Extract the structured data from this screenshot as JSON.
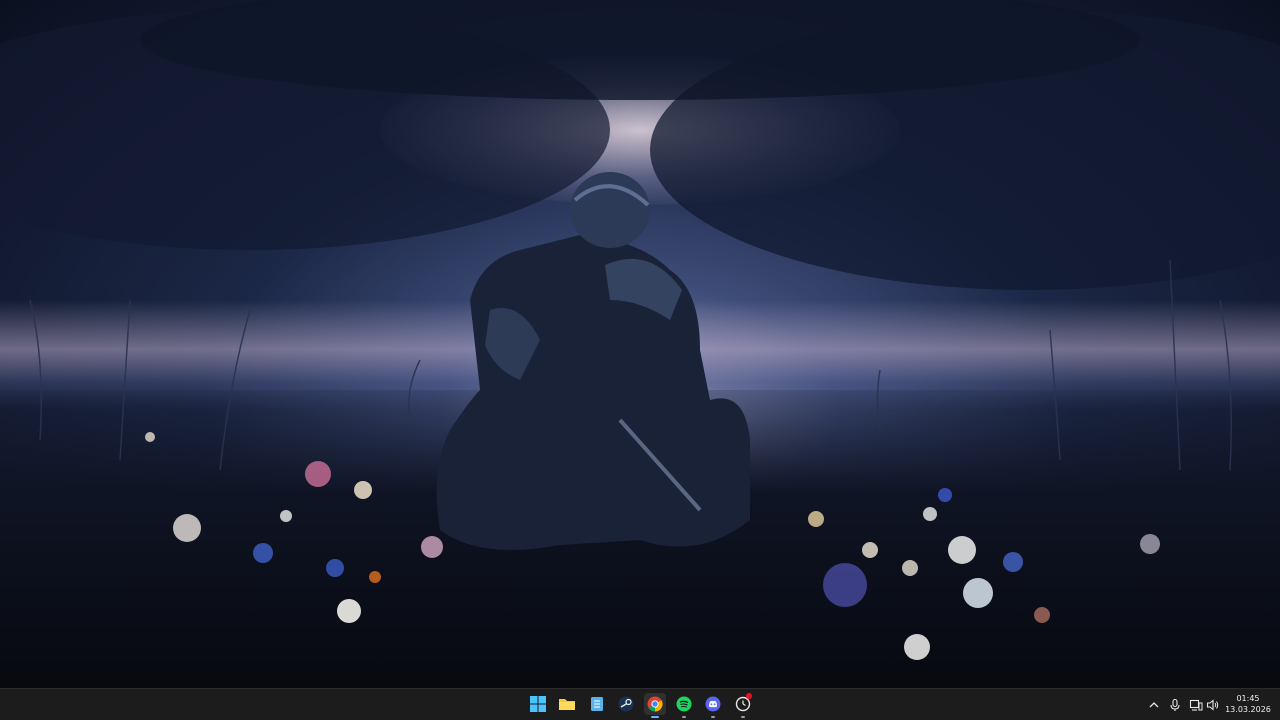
{
  "desktop": {
    "wallpaper": "knight-in-meadow-wallpaper"
  },
  "taskbar": {
    "apps": [
      {
        "name": "start-button",
        "icon": "windows-logo-icon",
        "running": false
      },
      {
        "name": "file-explorer",
        "icon": "folder-icon",
        "running": false
      },
      {
        "name": "notepad",
        "icon": "notepad-icon",
        "running": false
      },
      {
        "name": "steam",
        "icon": "steam-icon",
        "running": false
      },
      {
        "name": "chrome",
        "icon": "chrome-icon",
        "running": true,
        "active": true
      },
      {
        "name": "spotify",
        "icon": "spotify-icon",
        "running": true
      },
      {
        "name": "discord",
        "icon": "discord-icon",
        "running": true
      },
      {
        "name": "app-with-notification",
        "icon": "clock-app-icon",
        "running": true,
        "badge": true
      }
    ],
    "tray": {
      "icons": [
        "chevron-up-icon",
        "microphone-icon",
        "network-icon",
        "speaker-icon"
      ],
      "time": "01:45",
      "date": "13.03.2026"
    },
    "colors": {
      "background": "#1c1c1c",
      "accent": "#6fb4ff"
    }
  }
}
